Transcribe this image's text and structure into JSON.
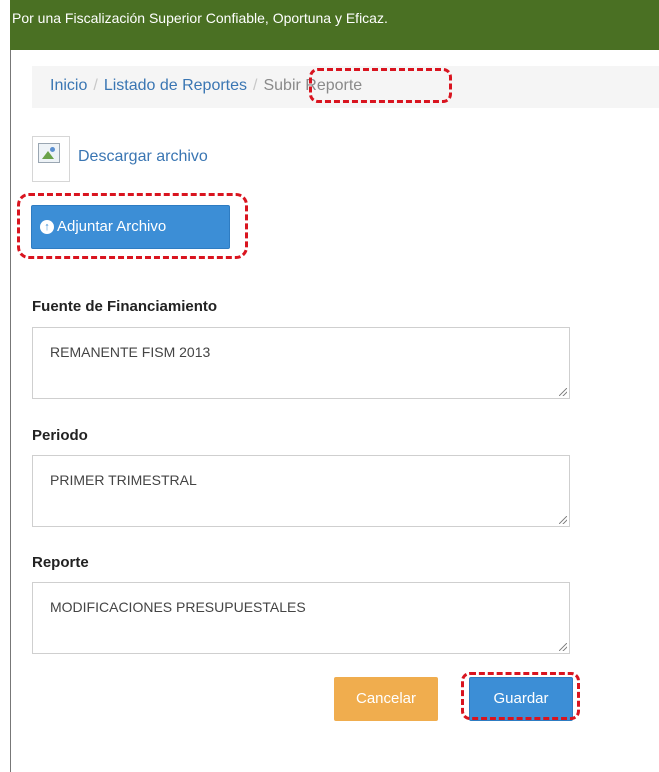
{
  "banner": {
    "text": "Por una Fiscalización Superior Confiable, Oportuna y Eficaz."
  },
  "breadcrumb": {
    "items": [
      "Inicio",
      "Listado de Reportes",
      "Subir Reporte"
    ],
    "separator": "/"
  },
  "download": {
    "label": "Descargar archivo",
    "icon": "broken-image-icon"
  },
  "attach": {
    "label": "Adjuntar Archivo",
    "icon": "upload-circle-icon"
  },
  "fields": [
    {
      "label": "Fuente de Financiamiento",
      "value": "REMANENTE FISM 2013"
    },
    {
      "label": "Periodo",
      "value": "PRIMER TRIMESTRAL"
    },
    {
      "label": "Reporte",
      "value": "MODIFICACIONES PRESUPUESTALES"
    }
  ],
  "actions": {
    "cancel_label": "Cancelar",
    "save_label": "Guardar"
  },
  "colors": {
    "banner": "#4a7023",
    "primary": "#3c8ed6",
    "warning": "#f0ad4e",
    "link": "#3a76b3",
    "highlight": "#d9141f"
  }
}
